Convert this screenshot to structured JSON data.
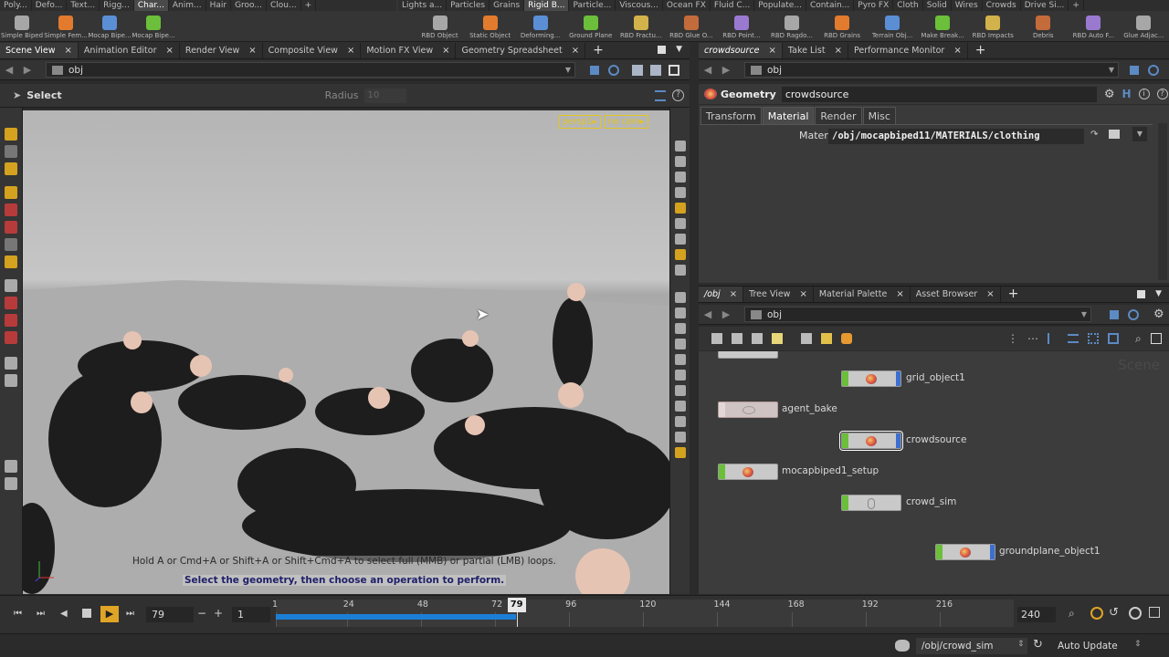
{
  "shelf_left": {
    "tabs": [
      "Poly...",
      "Defo...",
      "Text...",
      "Rigg...",
      "Char...",
      "Anim...",
      "Hair",
      "Groo...",
      "Clou..."
    ],
    "active_tab": 4,
    "tools": [
      "Simple Biped",
      "Simple Fem...",
      "Mocap Bipe...",
      "Mocap Bipe..."
    ]
  },
  "shelf_right": {
    "tabs": [
      "Lights a...",
      "Particles",
      "Grains",
      "Rigid B...",
      "Particle...",
      "Viscous...",
      "Ocean FX",
      "Fluid C...",
      "Populate...",
      "Contain...",
      "Pyro FX",
      "Cloth",
      "Solid",
      "Wires",
      "Crowds",
      "Drive Si..."
    ],
    "active_tab": 3,
    "tools": [
      "RBD Object",
      "Static Object",
      "Deforming...",
      "Ground Plane",
      "RBD Fractu...",
      "RBD Glue O...",
      "RBD Point...",
      "RBD Ragdo...",
      "RBD Grains",
      "Terrain Obj...",
      "Make Break...",
      "RBD Impacts",
      "Debris",
      "RBD Auto F...",
      "Glue Adjac..."
    ]
  },
  "left_pane": {
    "tabs": [
      "Scene View",
      "Animation Editor",
      "Render View",
      "Composite View",
      "Motion FX View",
      "Geometry Spreadsheet"
    ],
    "path": "obj",
    "select_label": "Select",
    "radius_label": "Radius",
    "radius_value": "10",
    "camera": "persp1",
    "cam_menu": "no cam",
    "hint1": "Hold A or Cmd+A or Shift+A or Shift+Cmd+A to select full (MMB) or partial (LMB) loops.",
    "hint2": "Select the geometry, then choose an operation to perform."
  },
  "params_pane": {
    "tabs": [
      "crowdsource",
      "Take List",
      "Performance Monitor"
    ],
    "path": "obj",
    "node_type": "Geometry",
    "node_name": "crowdsource",
    "param_tabs": [
      "Transform",
      "Material",
      "Render",
      "Misc"
    ],
    "active_param_tab": 1,
    "material_label": "Material",
    "material_value": "/obj/mocapbiped11/MATERIALS/clothing"
  },
  "network_pane": {
    "tabs": [
      "/obj",
      "Tree View",
      "Material Palette",
      "Asset Browser"
    ],
    "path": "obj",
    "watermark": "Scene",
    "nodes": [
      "grid_object1",
      "agent_bake",
      "crowdsource",
      "mocapbiped1_setup",
      "crowd_sim",
      "groundplane_object1"
    ]
  },
  "timeline": {
    "current_frame": "79",
    "start_frame": "1",
    "end_frame": "240",
    "ticks": [
      "1",
      "24",
      "48",
      "72",
      "96",
      "120",
      "144",
      "168",
      "192",
      "216"
    ],
    "marker": "79",
    "progress": 0.326
  },
  "statusbar": {
    "path": "/obj/crowd_sim",
    "update_mode": "Auto Update"
  }
}
